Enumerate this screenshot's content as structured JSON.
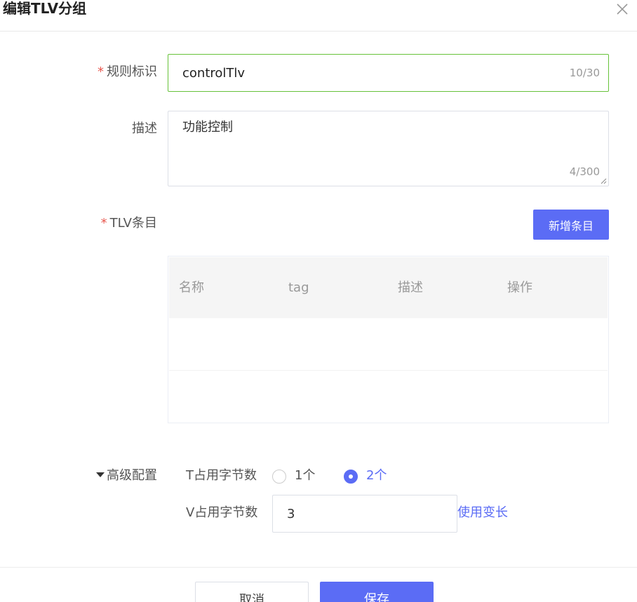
{
  "dialog": {
    "title": "编辑TLV分组"
  },
  "form": {
    "rule_id": {
      "required_mark": "*",
      "label": "规则标识",
      "value": "controlTlv",
      "counter": "10/30"
    },
    "description": {
      "label": "描述",
      "value": "功能控制",
      "counter": "4/300"
    },
    "tlv_items": {
      "required_mark": "*",
      "label": "TLV条目",
      "add_button_label": "新增条目",
      "columns": [
        "名称",
        "tag",
        "描述",
        "操作"
      ]
    },
    "advanced": {
      "label": "高级配置",
      "t_bytes": {
        "label": "T占用字节数",
        "options": [
          "1个",
          "2个"
        ],
        "selected": "2个"
      },
      "v_bytes": {
        "label": "V占用字节数",
        "value": "3",
        "link_label": "使用变长"
      }
    }
  },
  "footer": {
    "cancel_label": "取消",
    "save_label": "保存"
  },
  "colors": {
    "primary": "#5b6cf5",
    "valid_border": "#67c23a",
    "required": "#e8584f"
  }
}
